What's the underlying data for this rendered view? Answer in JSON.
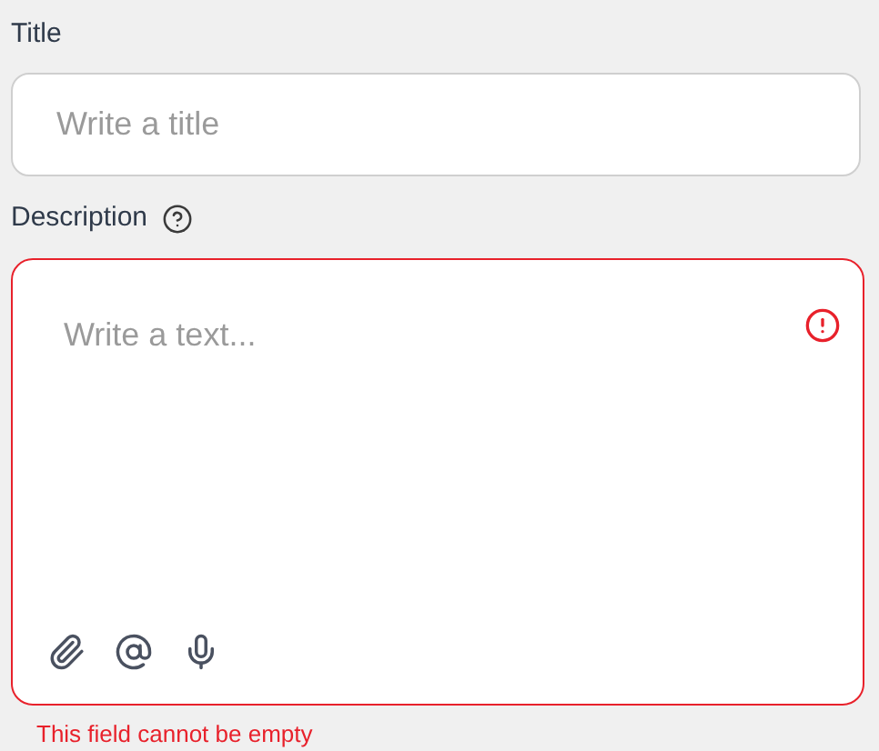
{
  "title_field": {
    "label": "Title",
    "placeholder": "Write a title"
  },
  "description_field": {
    "label": "Description",
    "placeholder": "Write a text...",
    "invalid": true,
    "error_message": "This field cannot be empty"
  }
}
